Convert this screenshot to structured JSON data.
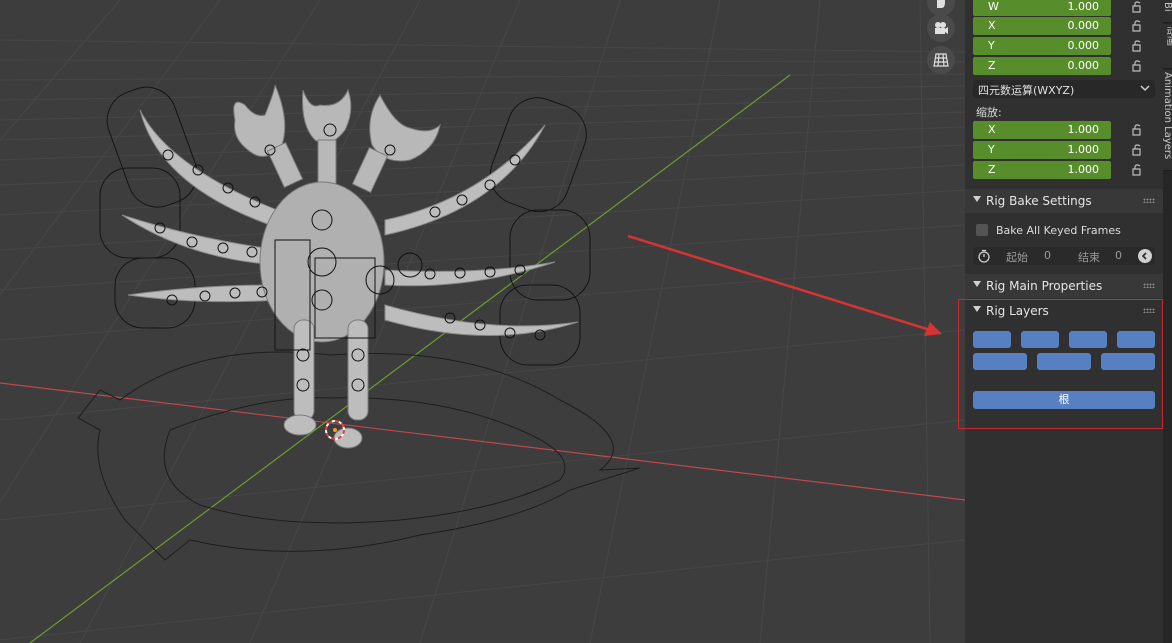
{
  "viewport": {
    "icons": [
      "hand-icon",
      "camera-icon",
      "grid-view-icon"
    ],
    "colors": {
      "background": "#3d3d3d",
      "x_axis": "#c0474b",
      "y_axis": "#6f9b2f",
      "annotation_arrow": "#d63434"
    }
  },
  "transform": {
    "quaternion": [
      {
        "label": "W",
        "value": "1.000"
      },
      {
        "label": "X",
        "value": "0.000"
      },
      {
        "label": "Y",
        "value": "0.000"
      },
      {
        "label": "Z",
        "value": "0.000"
      }
    ],
    "rotation_mode": "四元数运算(WXYZ)",
    "scale_label": "缩放:",
    "scale": [
      {
        "label": "X",
        "value": "1.000"
      },
      {
        "label": "Y",
        "value": "1.000"
      },
      {
        "label": "Z",
        "value": "1.000"
      }
    ]
  },
  "panels": {
    "bake": {
      "title": "Rig Bake Settings",
      "bake_all_label": "Bake All Keyed Frames",
      "start_label": "起始",
      "start_value": "0",
      "end_label": "结束",
      "end_value": "0"
    },
    "main_props": {
      "title": "Rig Main Properties"
    },
    "layers": {
      "title": "Rig Layers",
      "root_button_label": "根"
    }
  },
  "side_tabs": [
    "动画",
    "Animation Layers"
  ],
  "side_tab_top_partial": "Bi"
}
